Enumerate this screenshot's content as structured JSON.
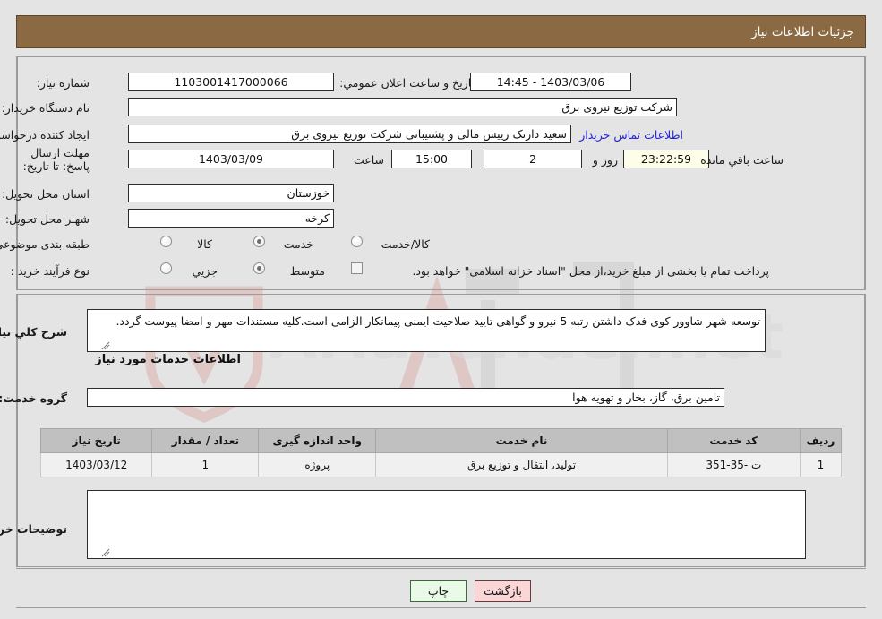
{
  "header": {
    "title": "جزئیات اطلاعات نیاز"
  },
  "top_form": {
    "need_number": {
      "label": "شماره نیاز:",
      "value": "1103001417000066"
    },
    "buyer_org": {
      "label": "نام دستگاه خریدار:",
      "value": "شرکت توزیع نیروی برق"
    },
    "request_creator": {
      "label": "ایجاد کننده درخواست:",
      "value": "سعید دارنک رییس مالی و پشتیبانی  شرکت توزیع نیروی برق"
    },
    "contact_link": "اطلاعات تماس خریدار",
    "deadline": {
      "label": "مهلت ارسال پاسخ: تا تاریخ:",
      "date": "1403/03/09",
      "time_label": "ساعت",
      "time": "15:00",
      "days": "2",
      "days_label": "روز و",
      "countdown": "23:22:59",
      "countdown_label": "ساعت باقي مانده"
    },
    "announce": {
      "label": "تاریخ و ساعت اعلان عمومي:",
      "value": "1403/03/06 - 14:45"
    },
    "province": {
      "label": "استان محل تحویل:",
      "value": "خوزستان"
    },
    "city": {
      "label": "شهـر محل تحویل:",
      "value": "کرخه"
    },
    "category": {
      "label": "طبقه بندی موضوعی:",
      "options": [
        "کالا",
        "خدمت",
        "کالا/خدمت"
      ],
      "selected": "خدمت"
    },
    "purchase_type": {
      "label": "نوع فرآیند خرید :",
      "options": [
        "جزیي",
        "متوسط"
      ],
      "selected": "متوسط",
      "checkbox_text": "پرداخت تمام یا بخشی از مبلغ خرید،از محل \"اسناد خزانه اسلامی\" خواهد بود.",
      "checkbox_checked": false
    }
  },
  "description": {
    "label": "شرح كلي نیاز:",
    "value": "توسعه شهر شاوور کوی فدک-داشتن رتبه 5 نیرو و گواهی تایید صلاحیت ایمنی پیمانکار الزامی است.کلیه مستندات مهر و امضا پیوست گردد."
  },
  "services_section": {
    "heading": "اطلاعات خدمات مورد نیاز",
    "service_group": {
      "label": "گروه خدمت:",
      "value": "تامین برق، گاز، بخار و تهویه هوا"
    },
    "table": {
      "columns": [
        "ردیف",
        "کد خدمت",
        "نام خدمت",
        "واحد اندازه گیری",
        "تعداد / مقدار",
        "تاریخ نیاز"
      ],
      "rows": [
        [
          "1",
          "ت -35-351",
          "تولید، انتقال و توزیع برق",
          "پروژه",
          "1",
          "1403/03/12"
        ]
      ]
    }
  },
  "buyer_notes": {
    "label": "توضیحات خریدار:",
    "value": ""
  },
  "footer": {
    "print_label": "چاپ",
    "back_label": "بازگشت"
  },
  "colors": {
    "header_bg": "#8b6a43",
    "page_bg": "#e4e4e4",
    "link": "#2222dd",
    "print_btn_bg": "#e9fbe6",
    "back_btn_bg": "#fad6d6",
    "table_header_bg": "#c0c0c0"
  },
  "watermark": {
    "text": "AriaTender.net"
  }
}
